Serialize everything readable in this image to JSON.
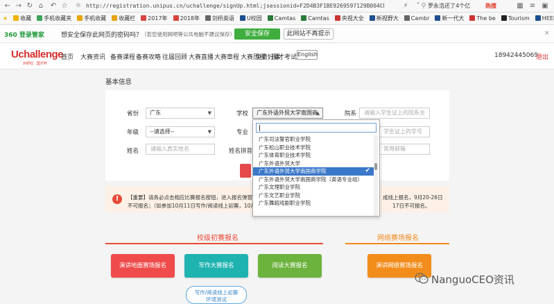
{
  "browser": {
    "url": "http://registration.unipus.cn/uchallenge/signUp.html;jsessionid=F2D4B3F1BE9269597129B004CB840F3",
    "news_text": "罗永浩还了4个亿",
    "hot_label": "热搜",
    "bookmarks": [
      {
        "label": "收藏",
        "color": "#f5b300"
      },
      {
        "label": "手机收藏夹",
        "color": "#3ba55c"
      },
      {
        "label": "手机收藏",
        "color": "#e9a200"
      },
      {
        "label": "收藏栏",
        "color": "#e9a200"
      },
      {
        "label": "2017年",
        "color": "#d64541"
      },
      {
        "label": "2018年",
        "color": "#d64541"
      },
      {
        "label": "剑桥英语",
        "color": "#666"
      },
      {
        "label": "U校园",
        "color": "#1d4f91"
      },
      {
        "label": "Camtas",
        "color": "#2a7a3a"
      },
      {
        "label": "Camtas",
        "color": "#2a7a3a"
      },
      {
        "label": "央视大全",
        "color": "#c33"
      },
      {
        "label": "新视野大",
        "color": "#1d4f91"
      },
      {
        "label": "Cambr",
        "color": "#666"
      },
      {
        "label": "新一代大",
        "color": "#1d4f91"
      },
      {
        "label": "The be",
        "color": "#c33"
      },
      {
        "label": "Tourism",
        "color": "#222"
      },
      {
        "label": "HEEP阶",
        "color": "#1d4f91"
      }
    ]
  },
  "password_bar": {
    "logo": "360 登录管家",
    "message": "想安全保存此网页的密码吗？",
    "note": "（若您使用网吧等公共电脑不建议保存）",
    "save_label": "安全保存",
    "never_label": "此网站不再提示",
    "close": "×"
  },
  "site": {
    "logo": "Uchallenge",
    "logo_sub": "外研社 · 国才杯",
    "nav": [
      "首页",
      "大赛资讯",
      "备赛课程",
      "备赛攻略",
      "往届回顾",
      "大赛直播",
      "大赛章程",
      "大赛历程",
      "免费好课",
      "国才考试"
    ],
    "lang_button": "English",
    "phone": "18942445069",
    "logout": "退出"
  },
  "form": {
    "section_title": "基本信息",
    "province_label": "省份",
    "province_value": "广东",
    "school_label": "学校",
    "school_value": "广东外语外贸大学南国商学",
    "college_label": "院系",
    "college_placeholder": "请输入学生证上的院系全称",
    "grade_label": "年级",
    "grade_value": "--请选择--",
    "major_label": "专业",
    "major_placeholder": "学生证上的学号",
    "name_label": "姓名",
    "name_placeholder": "请输入真实姓名",
    "pinyin_label": "姓名拼音",
    "email_placeholder": "常用邮箱"
  },
  "dropdown": {
    "search_value": "",
    "items": [
      "广东司法警官职业学院",
      "广东松山职业技术学院",
      "广东体育职业技术学院",
      "广东外语外贸大学",
      "广东外语外贸大学南国商学院",
      "广东外语外贸大学南国商学院（英语专业组）",
      "广东文理职业学院",
      "广东文艺职业学院",
      "广东舞蹈戏剧职业学院"
    ],
    "selected_index": 4,
    "check": "✔"
  },
  "notice": {
    "icon": "!",
    "line1": "【重要】请务必点击相应比赛报名按钮，进入报名弹窗，进行报名",
    "line1_right": "成线上报名，9月20-26日",
    "line2": "不可报名；（如参加10月11日写作/阅读线上初赛，10月5-11日",
    "line2_right": "17日不可报名。"
  },
  "sections": {
    "school_title": "校级初赛报名",
    "online_title": "网络赛场报名",
    "school_color": "#e84a3a",
    "online_color": "#f08a1c",
    "buttons": [
      {
        "label": "演讲地面赛场报名",
        "color": "#ef4b4b"
      },
      {
        "label": "写作大赛报名",
        "color": "#1fb3b0"
      },
      {
        "label": "阅读大赛报名",
        "color": "#6cb33e"
      },
      {
        "label": "演讲网络赛场报名",
        "color": "#f28c1a"
      }
    ],
    "test_line1": "写作/阅读线上初赛",
    "test_line2": "环境测试"
  },
  "watermark": "NanguoCEO资讯"
}
